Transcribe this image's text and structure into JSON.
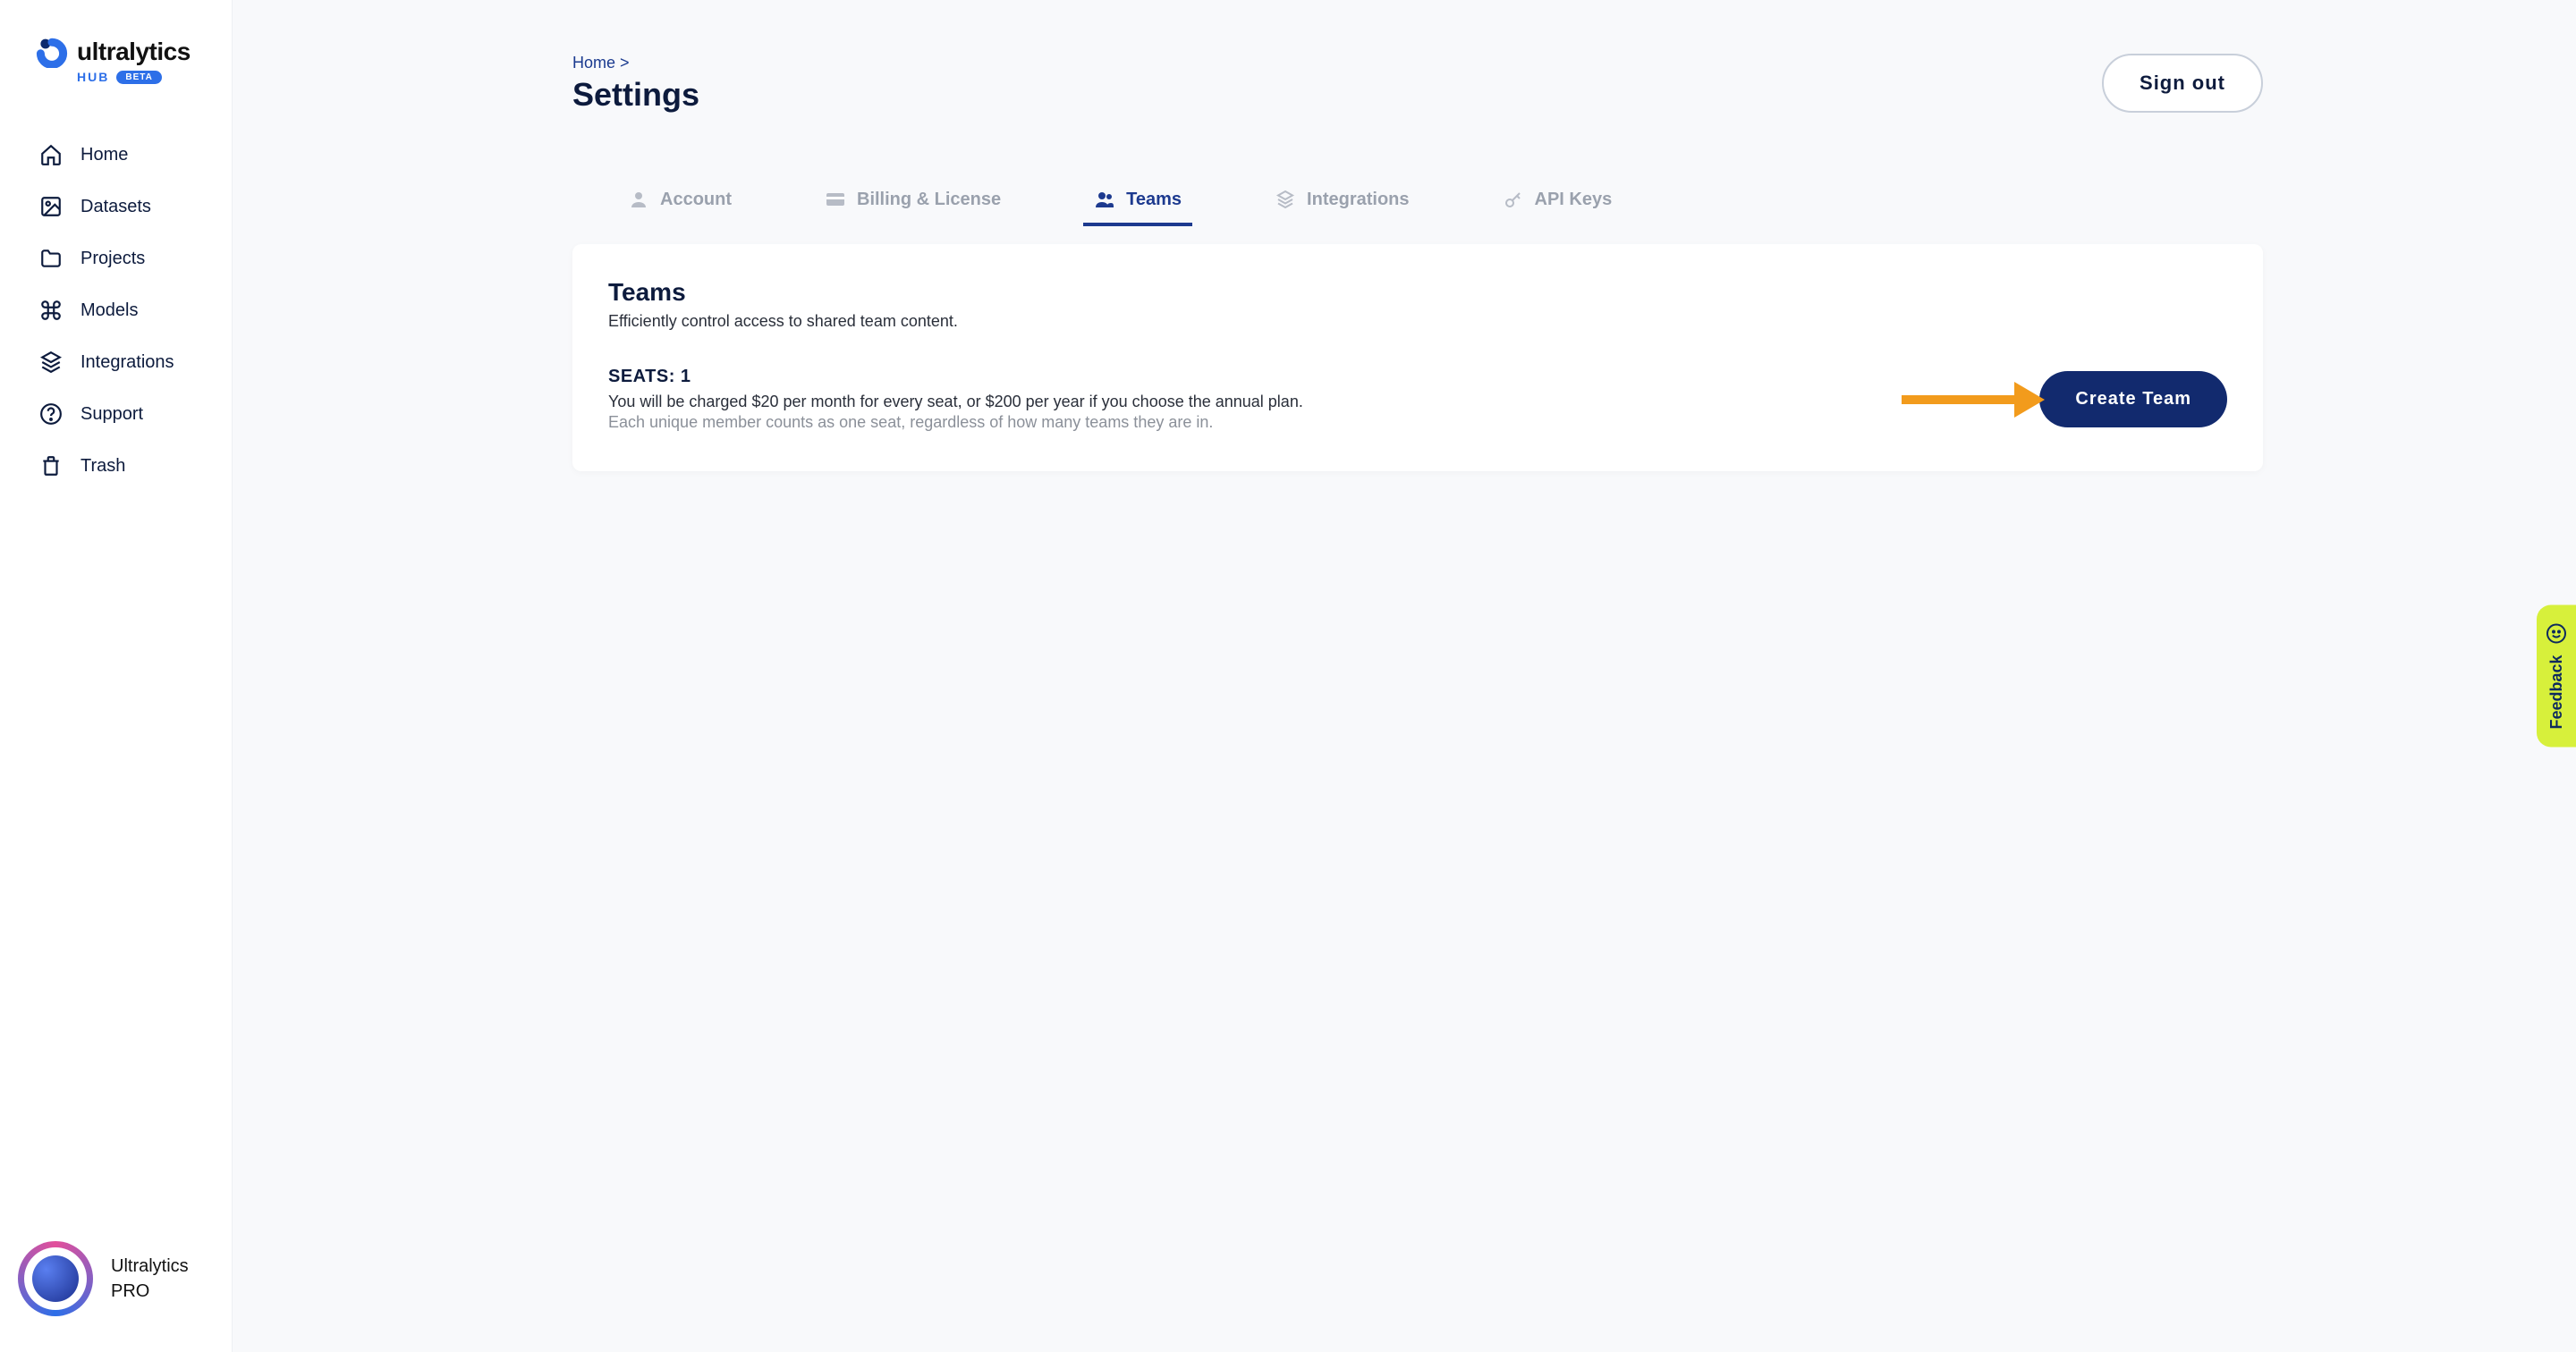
{
  "brand": {
    "name": "ultralytics",
    "sub": "HUB",
    "badge": "BETA"
  },
  "sidebar": {
    "items": [
      {
        "label": "Home"
      },
      {
        "label": "Datasets"
      },
      {
        "label": "Projects"
      },
      {
        "label": "Models"
      },
      {
        "label": "Integrations"
      },
      {
        "label": "Support"
      },
      {
        "label": "Trash"
      }
    ]
  },
  "profile": {
    "name": "Ultralytics",
    "plan": "PRO"
  },
  "breadcrumb": {
    "home": "Home",
    "sep": ">"
  },
  "page": {
    "title": "Settings"
  },
  "actions": {
    "sign_out": "Sign out"
  },
  "tabs": [
    {
      "label": "Account"
    },
    {
      "label": "Billing & License"
    },
    {
      "label": "Teams"
    },
    {
      "label": "Integrations"
    },
    {
      "label": "API Keys"
    }
  ],
  "teams_card": {
    "title": "Teams",
    "subtitle": "Efficiently control access to shared team content.",
    "seats_label": "SEATS: 1",
    "desc1": "You will be charged $20 per month for every seat, or $200 per year if you choose the annual plan.",
    "desc2": "Each unique member counts as one seat, regardless of how many teams they are in.",
    "create_label": "Create Team"
  },
  "feedback": {
    "label": "Feedback"
  }
}
